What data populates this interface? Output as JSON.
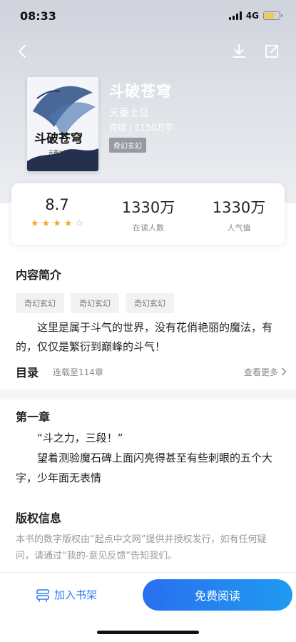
{
  "status_bar": {
    "time": "08:33",
    "network": "4G"
  },
  "book": {
    "title": "斗破苍穹",
    "author": "天蚕土豆",
    "status": "完结",
    "word_count": "1150万字",
    "category_tag": "奇幻玄幻",
    "cover_title": "斗破苍穹",
    "cover_author": "天蚕土豆"
  },
  "stats": [
    {
      "value": "8.7",
      "label": "",
      "stars": 4
    },
    {
      "value": "1330万",
      "label": "在读人数"
    },
    {
      "value": "1330万",
      "label": "人气值"
    }
  ],
  "intro": {
    "title": "内容简介",
    "tags": [
      "奇幻玄幻",
      "奇幻玄幻",
      "奇幻玄幻"
    ],
    "text": "这里是属于斗气的世界，没有花俏艳丽的魔法，有的，仅仅是繁衍到巅峰的斗气！"
  },
  "toc": {
    "label": "目录",
    "status": "连载至114章",
    "more": "查看更多"
  },
  "chapter": {
    "title": "第一章",
    "paragraphs": [
      "“斗之力，三段！”",
      "望着测验魔石碑上面闪亮得甚至有些刺眼的五个大字，少年面无表情"
    ]
  },
  "copyright": {
    "title": "版权信息",
    "text": "本书的数字版权由“起点中文网”提供并授权发行，如有任何疑问，请通过“我的-意见反馈”告知我们。"
  },
  "bottom_bar": {
    "shelf_label": "加入书架",
    "read_label": "免费阅读"
  },
  "colors": {
    "accent": "#2f7cf0",
    "star": "#f5a623"
  },
  "icons": [
    "back-icon",
    "download-icon",
    "share-icon",
    "bookshelf-icon",
    "chevron-right-icon",
    "star-icon"
  ]
}
